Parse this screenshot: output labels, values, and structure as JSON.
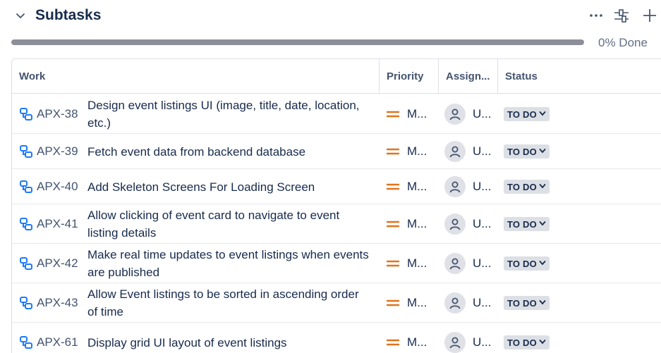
{
  "header": {
    "title": "Subtasks",
    "progress_label": "0% Done",
    "progress_value": 0
  },
  "table": {
    "columns": [
      "Work",
      "Priority",
      "Assign...",
      "Status"
    ],
    "rows": [
      {
        "key": "APX-38",
        "summary": "Design event listings UI (image, title, date, location, etc.)",
        "priority": "M...",
        "assignee": "U...",
        "status": "TO DO"
      },
      {
        "key": "APX-39",
        "summary": "Fetch event data from backend database",
        "priority": "M...",
        "assignee": "U...",
        "status": "TO DO"
      },
      {
        "key": "APX-40",
        "summary": "Add Skeleton Screens For Loading Screen",
        "priority": "M...",
        "assignee": "U...",
        "status": "TO DO"
      },
      {
        "key": "APX-41",
        "summary": "Allow clicking of event card to navigate to event listing details",
        "priority": "M...",
        "assignee": "U...",
        "status": "TO DO"
      },
      {
        "key": "APX-42",
        "summary": "Make real time updates to event listings when events are published",
        "priority": "M...",
        "assignee": "U...",
        "status": "TO DO"
      },
      {
        "key": "APX-43",
        "summary": "Allow Event listings to be sorted in ascending order of time",
        "priority": "M...",
        "assignee": "U...",
        "status": "TO DO"
      },
      {
        "key": "APX-61",
        "summary": "Display grid UI layout of event listings",
        "priority": "M...",
        "assignee": "U...",
        "status": "TO DO"
      }
    ]
  },
  "icons": {
    "collapse": "chevron-down-icon",
    "more": "more-icon",
    "filter": "filter-icon",
    "add": "plus-icon",
    "subtask": "subtask-icon",
    "priority": "priority-medium-icon",
    "avatar": "user-avatar-icon",
    "status_chevron": "chevron-down-icon"
  },
  "colors": {
    "subtask_icon": "#1d7afc",
    "priority_medium": "#e2731b",
    "progress_bar": "#8c8f97",
    "status_bg": "#dcdfe4"
  }
}
